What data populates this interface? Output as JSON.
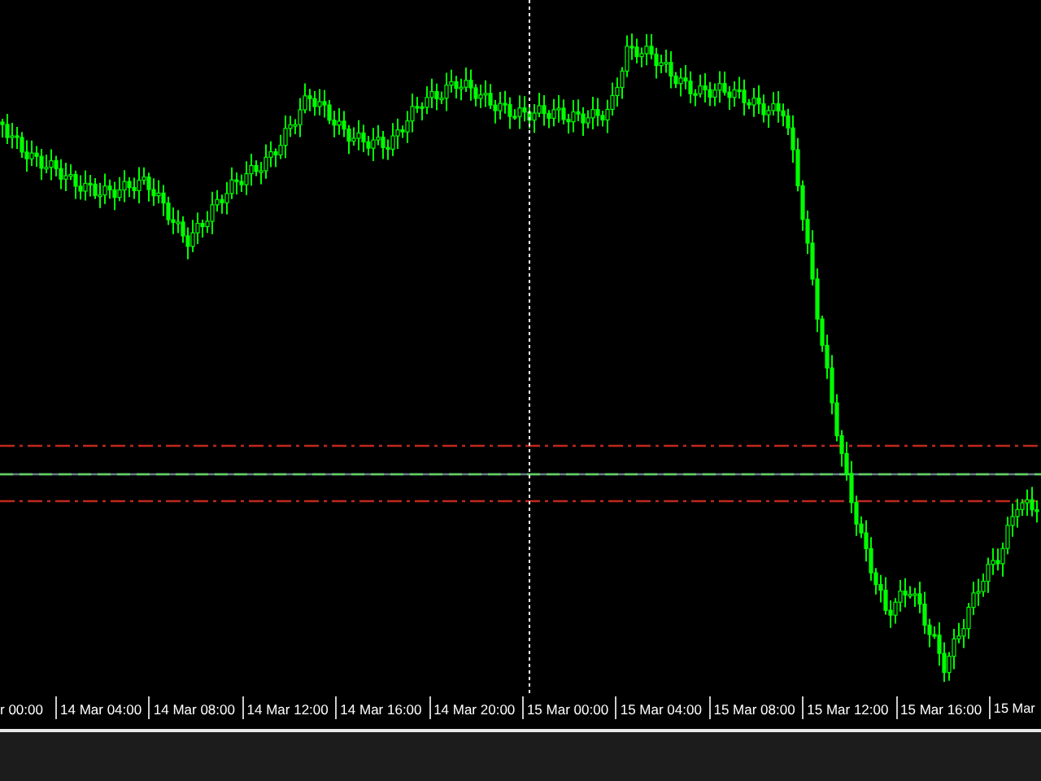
{
  "chart": {
    "time_labels": [
      "r 00:00",
      "14 Mar 04:00",
      "14 Mar 08:00",
      "14 Mar 12:00",
      "14 Mar 16:00",
      "14 Mar 20:00",
      "15 Mar 00:00",
      "15 Mar 04:00",
      "15 Mar 08:00",
      "15 Mar 12:00",
      "15 Mar 16:00",
      "15 Mar"
    ]
  }
}
